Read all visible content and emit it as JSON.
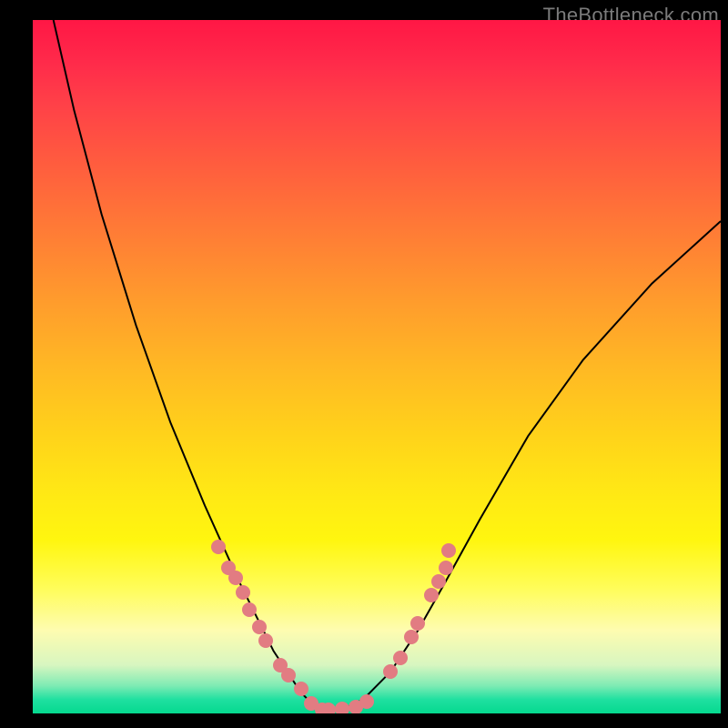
{
  "watermark": "TheBottleneck.com",
  "chart_data": {
    "type": "line",
    "title": "",
    "xlabel": "",
    "ylabel": "",
    "xlim": [
      0,
      100
    ],
    "ylim": [
      0,
      100
    ],
    "grid": false,
    "series": [
      {
        "name": "bottleneck-curve",
        "color": "#000000",
        "x": [
          3,
          6,
          10,
          15,
          20,
          25,
          30,
          33,
          35,
          37,
          39,
          41,
          43,
          45,
          48,
          52,
          56,
          60,
          65,
          72,
          80,
          90,
          100
        ],
        "y": [
          100,
          87,
          72,
          56,
          42,
          30,
          19,
          13,
          9,
          6,
          3,
          1,
          0.4,
          0.6,
          2,
          6,
          12,
          19,
          28,
          40,
          51,
          62,
          71
        ]
      }
    ],
    "points": [
      {
        "name": "cpu-point",
        "x": 27,
        "y": 24
      },
      {
        "name": "cpu-point",
        "x": 28.5,
        "y": 21
      },
      {
        "name": "cpu-point",
        "x": 29.5,
        "y": 19.5
      },
      {
        "name": "cpu-point",
        "x": 30.5,
        "y": 17.5
      },
      {
        "name": "cpu-point",
        "x": 31.5,
        "y": 15
      },
      {
        "name": "cpu-point",
        "x": 33,
        "y": 12.5
      },
      {
        "name": "cpu-point",
        "x": 33.8,
        "y": 10.5
      },
      {
        "name": "cpu-point",
        "x": 36,
        "y": 7
      },
      {
        "name": "cpu-point",
        "x": 37.2,
        "y": 5.5
      },
      {
        "name": "cpu-point",
        "x": 39,
        "y": 3.5
      },
      {
        "name": "cpu-point",
        "x": 40.5,
        "y": 1.5
      },
      {
        "name": "cpu-point",
        "x": 42,
        "y": 0.5
      },
      {
        "name": "cpu-point",
        "x": 43,
        "y": 0.5
      },
      {
        "name": "cpu-point",
        "x": 45,
        "y": 0.6
      },
      {
        "name": "cpu-point",
        "x": 47,
        "y": 0.9
      },
      {
        "name": "cpu-point",
        "x": 48.5,
        "y": 1.7
      },
      {
        "name": "cpu-point",
        "x": 52,
        "y": 6
      },
      {
        "name": "cpu-point",
        "x": 53.5,
        "y": 8
      },
      {
        "name": "cpu-point",
        "x": 55,
        "y": 11
      },
      {
        "name": "cpu-point",
        "x": 56,
        "y": 13
      },
      {
        "name": "cpu-point",
        "x": 58,
        "y": 17
      },
      {
        "name": "cpu-point",
        "x": 59,
        "y": 19
      },
      {
        "name": "cpu-point",
        "x": 60,
        "y": 21
      },
      {
        "name": "cpu-point",
        "x": 60.5,
        "y": 23.5
      }
    ],
    "point_color": "#e27c82",
    "background": "rainbow-vertical-gradient"
  }
}
